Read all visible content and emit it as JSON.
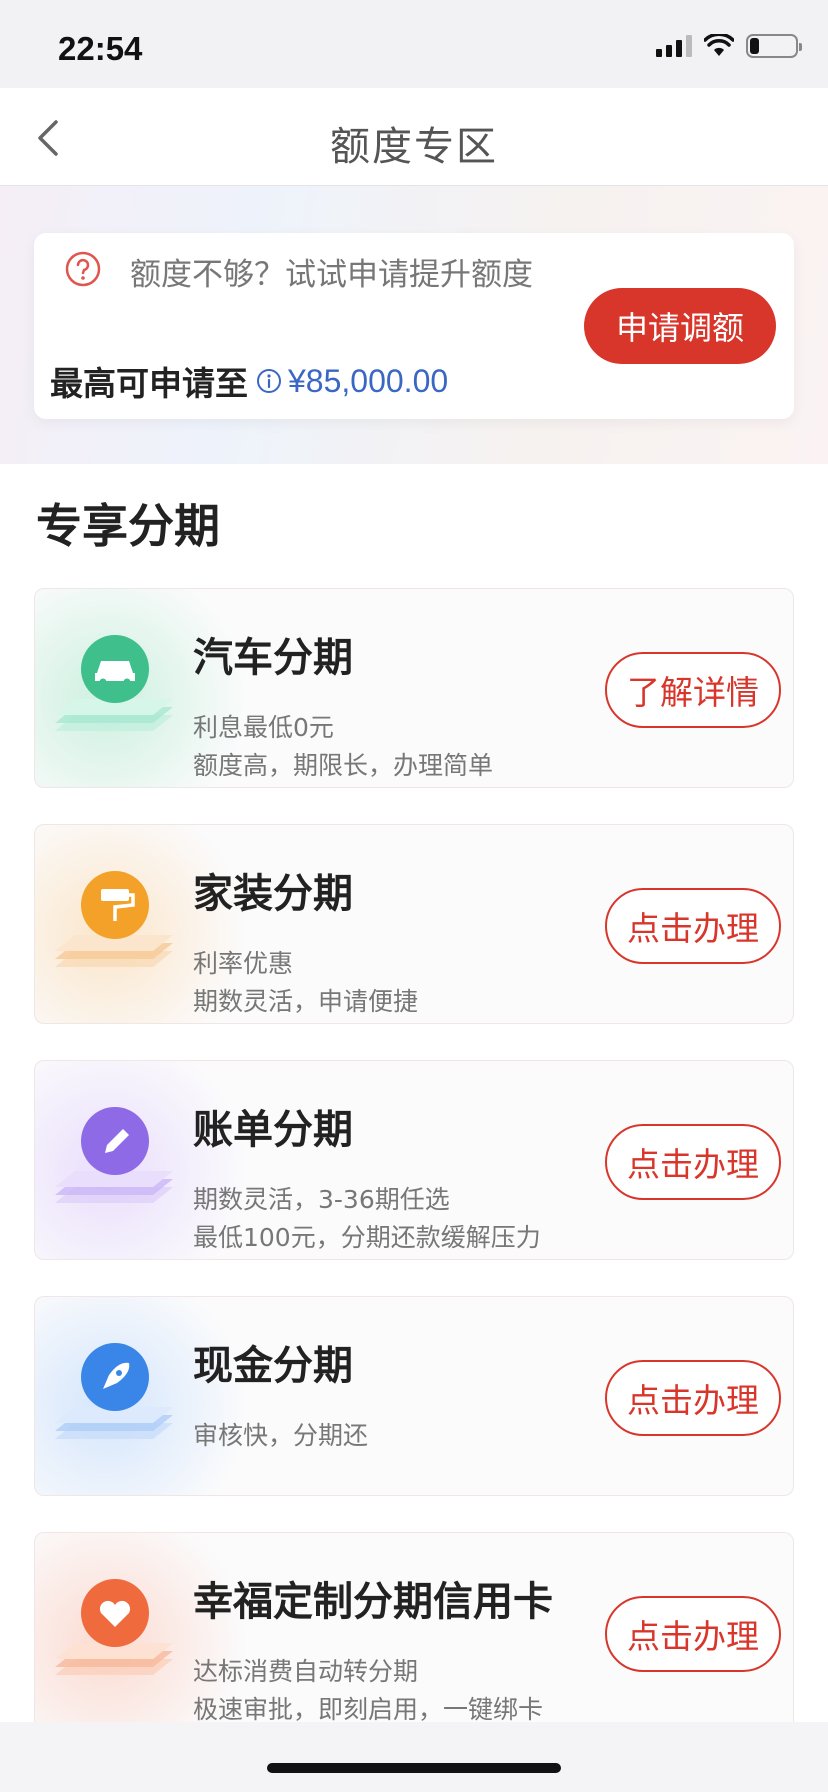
{
  "status_bar": {
    "time": "22:54",
    "battery_level": 0.2
  },
  "nav": {
    "title": "额度专区",
    "back_icon": "chevron-left-icon"
  },
  "quota": {
    "prompt": "额度不够？试试申请提升额度",
    "limit_label": "最高可申请至",
    "limit_value": "¥85,000.00",
    "button_label": "申请调额",
    "accent": "#d9362b",
    "value_color": "#3a66c4"
  },
  "section": {
    "title": "专享分期"
  },
  "products": [
    {
      "title": "汽车分期",
      "desc1": "利息最低0元",
      "desc2": "额度高，期限长，办理简单",
      "button": "了解详情",
      "icon": "car-icon",
      "color": "#3fbf8c"
    },
    {
      "title": "家装分期",
      "desc1": "利率优惠",
      "desc2": "期数灵活，申请便捷",
      "button": "点击办理",
      "icon": "paint-roller-icon",
      "color": "#f4a12a"
    },
    {
      "title": "账单分期",
      "desc1": "期数灵活，3-36期任选",
      "desc2": "最低100元，分期还款缓解压力",
      "button": "点击办理",
      "icon": "pencil-icon",
      "color": "#8f6ae6"
    },
    {
      "title": "现金分期",
      "desc1": "审核快，分期还",
      "desc2": "",
      "button": "点击办理",
      "icon": "rocket-icon",
      "color": "#3a86e8"
    },
    {
      "title": "幸福定制分期信用卡",
      "desc1": "达标消费自动转分期",
      "desc2": "极速审批，即刻启用，一键绑卡",
      "button": "点击办理",
      "icon": "heart-icon",
      "color": "#ef6a3d"
    }
  ]
}
